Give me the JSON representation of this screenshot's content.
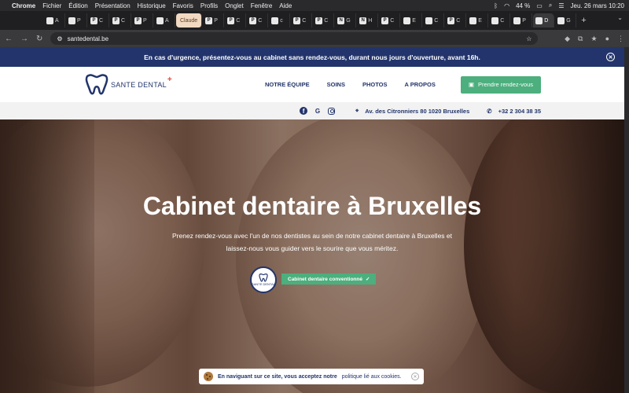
{
  "os_menubar": {
    "app": "Chrome",
    "items": [
      "Fichier",
      "Édition",
      "Présentation",
      "Historique",
      "Favoris",
      "Profils",
      "Onglet",
      "Fenêtre",
      "Aide"
    ],
    "battery": "44 %",
    "datetime": "Jeu. 26 mars  10:20"
  },
  "tabs": [
    {
      "fav": "",
      "label": "A"
    },
    {
      "fav": "",
      "label": "P"
    },
    {
      "fav": "P",
      "label": "C"
    },
    {
      "fav": "P",
      "label": "C"
    },
    {
      "fav": "P",
      "label": "P"
    },
    {
      "fav": "",
      "label": "A"
    },
    {
      "fav": "",
      "label": "Claude"
    },
    {
      "fav": "P",
      "label": "P"
    },
    {
      "fav": "P",
      "label": "C"
    },
    {
      "fav": "P",
      "label": "C"
    },
    {
      "fav": "",
      "label": "c"
    },
    {
      "fav": "P",
      "label": "C"
    },
    {
      "fav": "P",
      "label": "C"
    },
    {
      "fav": "N",
      "label": "G"
    },
    {
      "fav": "N",
      "label": "H"
    },
    {
      "fav": "P",
      "label": "C"
    },
    {
      "fav": "",
      "label": "E"
    },
    {
      "fav": "",
      "label": "C"
    },
    {
      "fav": "P",
      "label": "C"
    },
    {
      "fav": "",
      "label": "E"
    },
    {
      "fav": "",
      "label": "C"
    },
    {
      "fav": "",
      "label": "P"
    },
    {
      "fav": "",
      "label": "D"
    },
    {
      "fav": "",
      "label": "G"
    }
  ],
  "address_bar": {
    "url": "santedental.be"
  },
  "site": {
    "urgent_banner": "En cas d'urgence, présentez-vous au cabinet sans rendez-vous, durant nous jours d'ouverture, avant 16h.",
    "logo_text": "SANTE DENTAL",
    "nav": [
      "NOTRE ÉQUIPE",
      "SOINS",
      "PHOTOS",
      "A PROPOS"
    ],
    "cta": "Prendre rendez-vous",
    "address": "Av. des Citronniers 80 1020 Bruxelles",
    "phone": "+32 2 304 38 35",
    "hero_title": "Cabinet dentaire à Bruxelles",
    "hero_subtitle": "Prenez rendez-vous avec l'un de nos dentistes au sein de notre cabinet dentaire à Bruxelles et laissez-nous vous guider vers le sourire que vous méritez.",
    "badge_logo_text": "SANTE DENTAL",
    "badge_label": "Cabinet dentaire conventionné",
    "cookie_text_bold": "En naviguant sur ce site, vous acceptez notre",
    "cookie_text_link": "politique lié aux cookies."
  }
}
